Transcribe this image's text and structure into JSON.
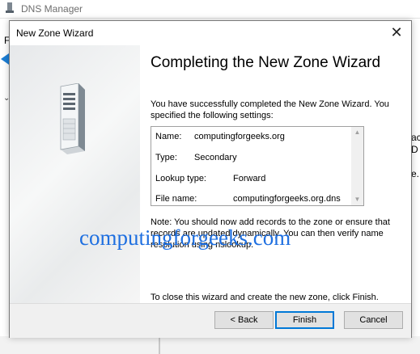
{
  "background_window": {
    "title": "DNS Manager",
    "menu_fragment": "F",
    "right_fragments": [
      "ac",
      "D",
      "e."
    ]
  },
  "dialog": {
    "title": "New Zone Wizard",
    "heading": "Completing the New Zone Wizard",
    "intro": "You have successfully completed the New Zone Wizard. You specified the following settings:",
    "settings": [
      {
        "label": "Name:",
        "value": "computingforgeeks.org"
      },
      {
        "label": "Type:",
        "value": "Secondary"
      },
      {
        "label": "Lookup type:",
        "value": "Forward"
      },
      {
        "label": "File name:",
        "value": "computingforgeeks.org.dns"
      }
    ],
    "note": "Note: You should now add records to the zone or ensure that records are updated dynamically. You can then verify name resolution using nslookup.",
    "finish_instruction": "To close this wizard and create the new zone, click Finish.",
    "buttons": {
      "back": "< Back",
      "finish": "Finish",
      "cancel": "Cancel"
    },
    "close_icon": "close-icon"
  },
  "watermark": "computingforgeeks.com"
}
